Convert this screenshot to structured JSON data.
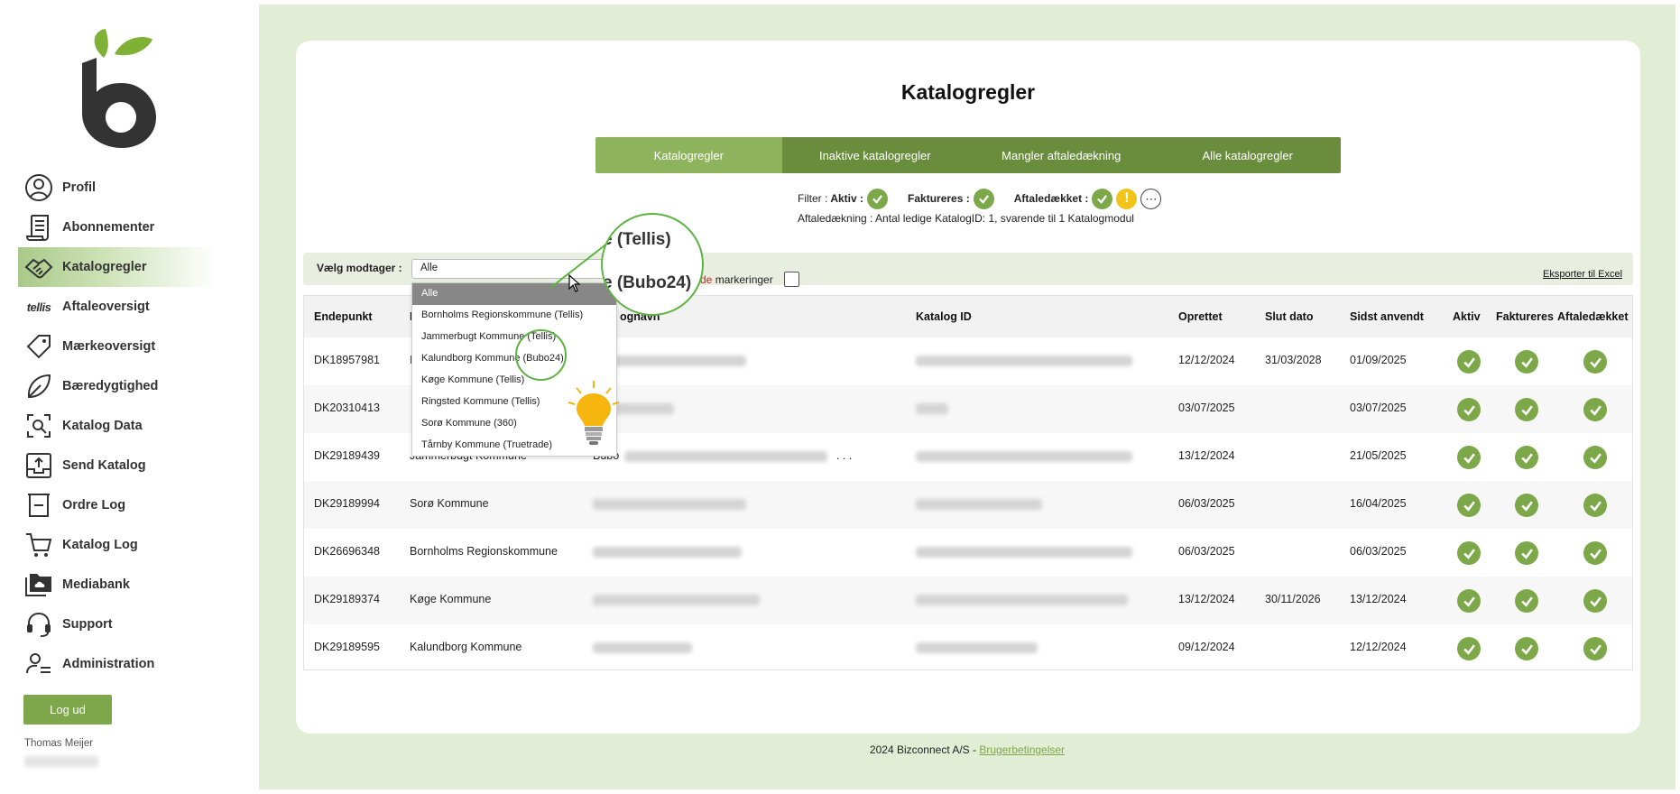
{
  "sidebar": {
    "items": [
      {
        "label": "Profil",
        "icon": "user-circle-icon"
      },
      {
        "label": "Abonnementer",
        "icon": "receipt-icon"
      },
      {
        "label": "Katalogregler",
        "icon": "handshake-icon"
      },
      {
        "label": "Aftaleoversigt",
        "icon": "tellis-logo-icon"
      },
      {
        "label": "Mærkeoversigt",
        "icon": "tag-icon"
      },
      {
        "label": "Bæredygtighed",
        "icon": "leaf-icon"
      },
      {
        "label": "Katalog Data",
        "icon": "search-document-icon"
      },
      {
        "label": "Send Katalog",
        "icon": "upload-tray-icon"
      },
      {
        "label": "Ordre Log",
        "icon": "basket-icon"
      },
      {
        "label": "Katalog Log",
        "icon": "cart-icon"
      },
      {
        "label": "Mediabank",
        "icon": "folder-cloud-icon"
      },
      {
        "label": "Support",
        "icon": "headset-icon"
      },
      {
        "label": "Administration",
        "icon": "user-settings-icon"
      }
    ],
    "tellis_text": "tellis",
    "logout_label": "Log ud",
    "username": "Thomas Meijer"
  },
  "main": {
    "title": "Katalogregler",
    "tabs": [
      {
        "label": "Katalogregler"
      },
      {
        "label": "Inaktive katalogregler"
      },
      {
        "label": "Mangler aftaledækning"
      },
      {
        "label": "Alle katalogregler"
      }
    ],
    "filter": {
      "prefix": "Filter :",
      "aktiv": "Aktiv :",
      "faktureres": "Faktureres :",
      "aftaledaekket": "Aftaledækket :",
      "warn_symbol": "!",
      "more_symbol": "⋯"
    },
    "coverage_text": "Aftaledækning :   Antal ledige KatalogID: 1, svarende til 1 Katalogmodul",
    "select_label": "Vælg modtager :",
    "select_value": "Alle",
    "marker_red": "de",
    "marker_text": " markeringer",
    "export_label": "Eksporter til Excel",
    "dropdown_options": [
      "Alle",
      "Bornholms Regionskommune (Tellis)",
      "Jammerbugt Kommune (Tellis)",
      "Kalundborg Kommune (Bubo24)",
      "Køge Kommune (Tellis)",
      "Ringsted Kommune (Tellis)",
      "Sorø Kommune (360)",
      "Tårnby Kommune (Truetrade)"
    ],
    "magnifier": {
      "line1": "e (Tellis)",
      "line2": "e (Bubo24)"
    }
  },
  "table": {
    "headers": {
      "endepunkt": "Endepunkt",
      "modtager": "I",
      "katalognavn": "ognavn",
      "katalog_id": "Katalog ID",
      "oprettet": "Oprettet",
      "slut": "Slut dato",
      "sidst": "Sidst anvendt",
      "aktiv": "Aktiv",
      "faktureres": "Faktureres",
      "aftaledaekket": "Aftaledækket"
    },
    "rows": [
      {
        "endepunkt": "DK18957981",
        "modtager": "I",
        "katalognavn": "",
        "oprettet": "12/12/2024",
        "slut": "31/03/2028",
        "sidst": "01/09/2025"
      },
      {
        "endepunkt": "DK20310413",
        "modtager": "",
        "katalognavn": "",
        "oprettet": "03/07/2025",
        "slut": "",
        "sidst": "03/07/2025"
      },
      {
        "endepunkt": "DK29189439",
        "modtager": "Jammerbugt Kommune",
        "katalognavn": "Bubo",
        "oprettet": "13/12/2024",
        "slut": "",
        "sidst": "21/05/2025"
      },
      {
        "endepunkt": "DK29189994",
        "modtager": "Sorø Kommune",
        "katalognavn": "",
        "oprettet": "06/03/2025",
        "slut": "",
        "sidst": "16/04/2025"
      },
      {
        "endepunkt": "DK26696348",
        "modtager": "Bornholms Regionskommune",
        "katalognavn": "",
        "oprettet": "06/03/2025",
        "slut": "",
        "sidst": "06/03/2025"
      },
      {
        "endepunkt": "DK29189374",
        "modtager": "Køge Kommune",
        "katalognavn": "",
        "oprettet": "13/12/2024",
        "slut": "30/11/2026",
        "sidst": "13/12/2024"
      },
      {
        "endepunkt": "DK29189595",
        "modtager": "Kalundborg Kommune",
        "katalognavn": "",
        "oprettet": "09/12/2024",
        "slut": "",
        "sidst": "12/12/2024"
      }
    ],
    "ellipsis": ". . ."
  },
  "footer": {
    "text": "2024 Bizconnect A/S - ",
    "link": "Brugerbetingelser"
  },
  "colors": {
    "brand_green": "#7ea64b",
    "tab_dark": "#6a8d3d",
    "tab_active": "#8db45c",
    "page_bg": "#e2edd5",
    "warn": "#f2c318",
    "highlight": "#5db443"
  }
}
